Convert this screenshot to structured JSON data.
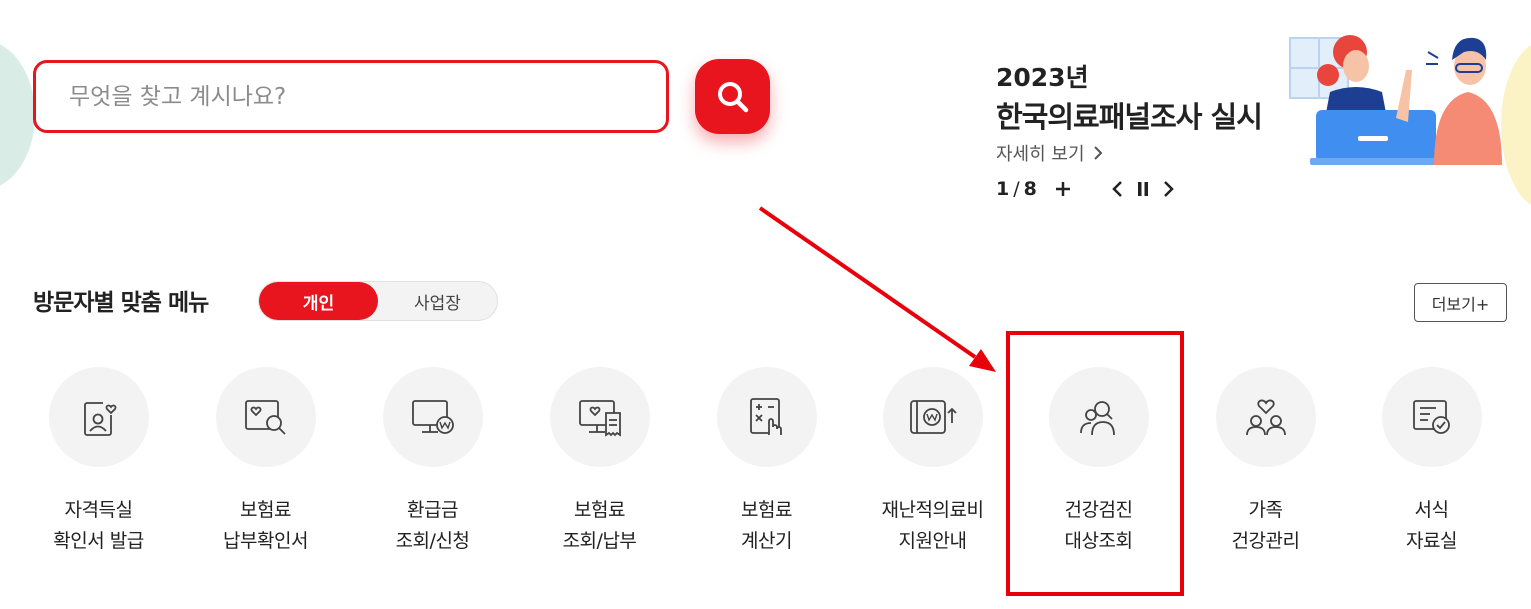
{
  "search": {
    "placeholder": "무엇을 찾고 계시나요?",
    "icon": "search-icon"
  },
  "banner": {
    "year": "2023년",
    "title": "한국의료패널조사 실시",
    "more_label": "자세히 보기",
    "pager": {
      "current": "1",
      "separator": "/",
      "total": "8"
    }
  },
  "menu": {
    "heading": "방문자별 맞춤 메뉴",
    "toggle": {
      "personal": "개인",
      "business": "사업장",
      "selected": "개인"
    },
    "more_label": "더보기+",
    "items": [
      {
        "line1": "자격득실",
        "line2": "확인서 발급",
        "icon": "id-card-heart-icon"
      },
      {
        "line1": "보험료",
        "line2": "납부확인서",
        "icon": "document-search-icon"
      },
      {
        "line1": "환급금",
        "line2": "조회/신청",
        "icon": "monitor-won-icon"
      },
      {
        "line1": "보험료",
        "line2": "조회/납부",
        "icon": "monitor-receipt-icon"
      },
      {
        "line1": "보험료",
        "line2": "계산기",
        "icon": "calculator-hand-icon"
      },
      {
        "line1": "재난적의료비",
        "line2": "지원안내",
        "icon": "wallet-won-icon"
      },
      {
        "line1": "건강검진",
        "line2": "대상조회",
        "icon": "people-search-icon"
      },
      {
        "line1": "가족",
        "line2": "건강관리",
        "icon": "family-heart-icon"
      },
      {
        "line1": "서식",
        "line2": "자료실",
        "icon": "form-check-icon"
      }
    ]
  },
  "colors": {
    "accent": "#e8141e",
    "annotation": "#e8000b",
    "icon_bg": "#f3f3f3"
  }
}
